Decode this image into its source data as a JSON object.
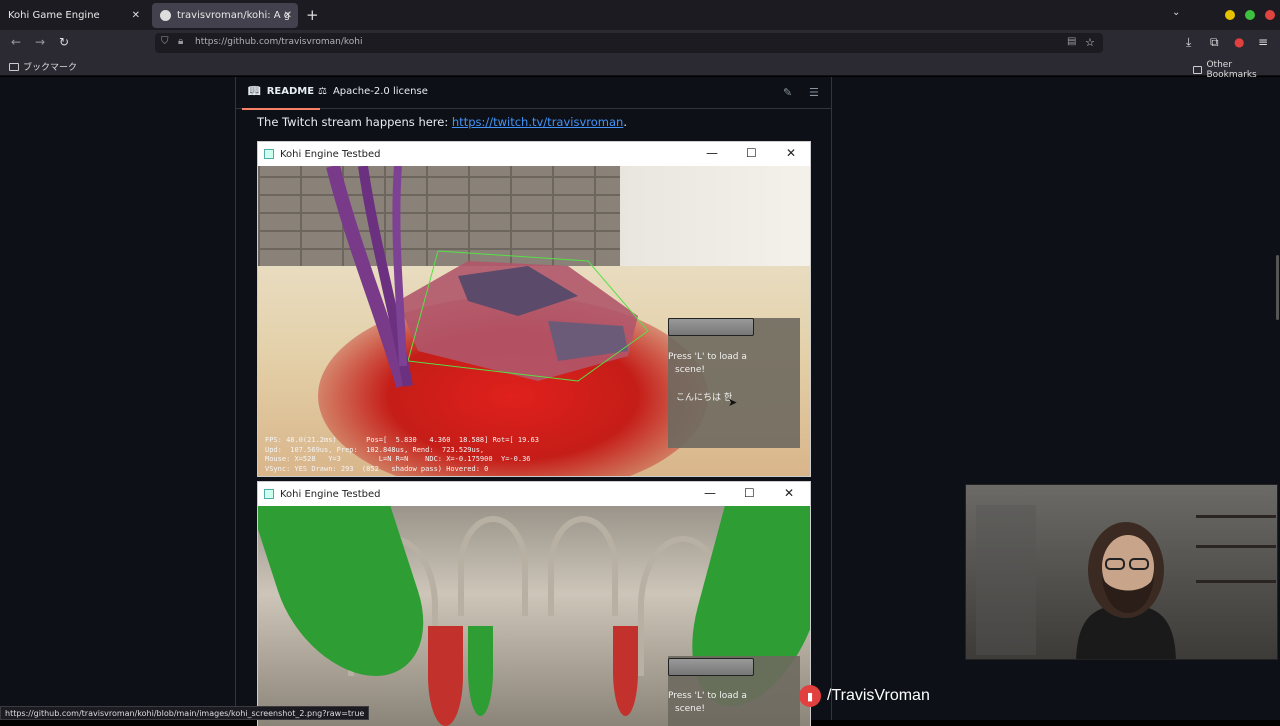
{
  "browser": {
    "tabs": [
      {
        "label": "Kohi Game Engine",
        "active": false
      },
      {
        "label": "travisvroman/kohi: A game e",
        "active": true
      }
    ],
    "url": "https://github.com/travisvroman/kohi",
    "bookmarks_label": "ブックマーク",
    "other_bookmarks_label": "Other Bookmarks",
    "status_url": "https://github.com/travisvroman/kohi/blob/main/images/kohi_screenshot_2.png?raw=true"
  },
  "readme": {
    "tab_readme": "README",
    "tab_license": "Apache-2.0 license",
    "twitch_text": "The Twitch stream happens here: ",
    "twitch_link": "https://twitch.tv/travisvroman",
    "twitch_end": "."
  },
  "window1": {
    "title": "Kohi Engine Testbed",
    "press_text_1": "Press 'L' to load a",
    "press_text_2": "scene!",
    "jp_text": "こんにちは 한",
    "stats": [
      "FPS: 48.0(21.2ms)       Pos=[  5.830   4.360  18.588] Rot=[ 19.63",
      "Upd:  107.569us, Prep:  102.848us, Rend:  723.529us,",
      "Mouse: X=528   Y=3         L=N R=N    NDC: X=-0.175900  Y=-0.36",
      "VSync: YES Drawn: 293  (852   shadow pass) Hovered: 0"
    ]
  },
  "window2": {
    "title": "Kohi Engine Testbed",
    "press_text_1": "Press 'L' to load a",
    "press_text_2": "scene!"
  },
  "stream": {
    "handle": "/TravisVroman"
  },
  "colors": {
    "link": "#4493f8",
    "accent": "#f78166",
    "twitch": "#e23f3f"
  }
}
